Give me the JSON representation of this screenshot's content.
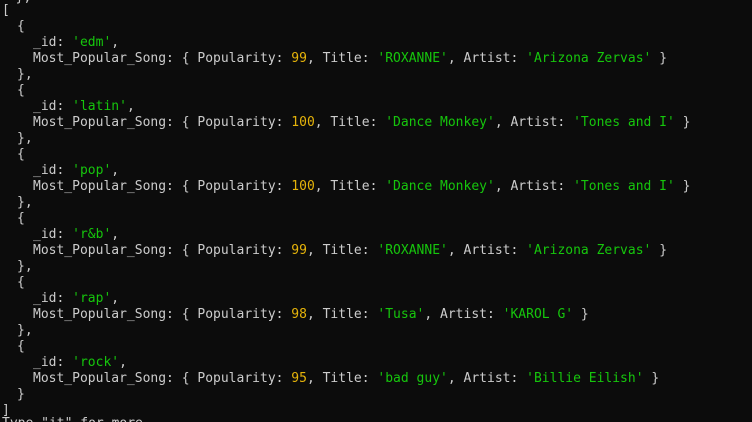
{
  "punct": {
    "open_array": "[",
    "close_array": "]",
    "open_obj": "{",
    "close_obj": "}",
    "close_obj_comma": "},",
    "id_key": "_id: ",
    "comma": ",",
    "song_key": "Most_Popular_Song: { ",
    "pop_key": "Popularity: ",
    "title_key": ", Title: ",
    "artist_key": ", Artist: ",
    "inner_close": " }"
  },
  "top_partial": "  },",
  "bottom_partial": "Type \"it\" for more",
  "records": [
    {
      "id": "'edm'",
      "popularity": "99",
      "title": "'ROXANNE'",
      "artist": "'Arizona Zervas'"
    },
    {
      "id": "'latin'",
      "popularity": "100",
      "title": "'Dance Monkey'",
      "artist": "'Tones and I'"
    },
    {
      "id": "'pop'",
      "popularity": "100",
      "title": "'Dance Monkey'",
      "artist": "'Tones and I'"
    },
    {
      "id": "'r&b'",
      "popularity": "99",
      "title": "'ROXANNE'",
      "artist": "'Arizona Zervas'"
    },
    {
      "id": "'rap'",
      "popularity": "98",
      "title": "'Tusa'",
      "artist": "'KAROL G'"
    },
    {
      "id": "'rock'",
      "popularity": "95",
      "title": "'bad guy'",
      "artist": "'Billie Eilish'"
    }
  ],
  "colors": {
    "background": "#0c0c0c",
    "text": "#cccccc",
    "string": "#16c60c",
    "number": "#e5b30a"
  }
}
